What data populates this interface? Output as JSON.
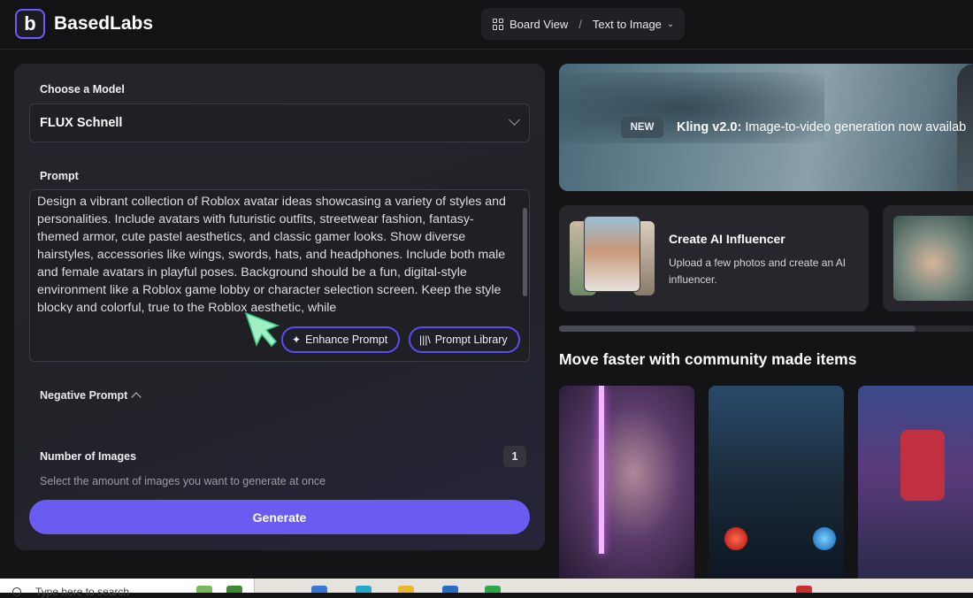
{
  "header": {
    "logo_letter": "b",
    "brand": "BasedLabs",
    "breadcrumb": {
      "board_view": "Board View",
      "separator": "/",
      "current": "Text to Image"
    }
  },
  "form": {
    "model_label": "Choose a Model",
    "model_value": "FLUX Schnell",
    "prompt_label": "Prompt",
    "prompt_value": "Design a vibrant collection of Roblox avatar ideas showcasing a variety of styles and personalities. Include avatars with futuristic outfits, streetwear fashion, fantasy-themed armor, cute pastel aesthetics, and classic gamer looks. Show diverse hairstyles, accessories like wings, swords, hats, and headphones. Include both male and female avatars in playful poses. Background should be a fun, digital-style environment like a Roblox game lobby or character selection screen. Keep the style blocky and colorful, true to the Roblox aesthetic, while",
    "enhance_prompt": "Enhance Prompt",
    "prompt_library": "Prompt Library",
    "negative_prompt_label": "Negative Prompt",
    "num_images_label": "Number of Images",
    "num_images_value": "1",
    "num_images_help": "Select the amount of images you want to generate at once",
    "generate": "Generate"
  },
  "hero": {
    "badge": "NEW",
    "title": "Kling v2.0:",
    "text": " Image-to-video generation now availab"
  },
  "cards": [
    {
      "title": "Create AI Influencer",
      "desc": "Upload a few photos and create an AI influencer."
    }
  ],
  "community": {
    "title": "Move faster with community made items"
  },
  "taskbar": {
    "search_placeholder": "Type here to search"
  },
  "colors": {
    "accent": "#6a5cf0",
    "panel": "#24242a",
    "background": "#141417"
  }
}
